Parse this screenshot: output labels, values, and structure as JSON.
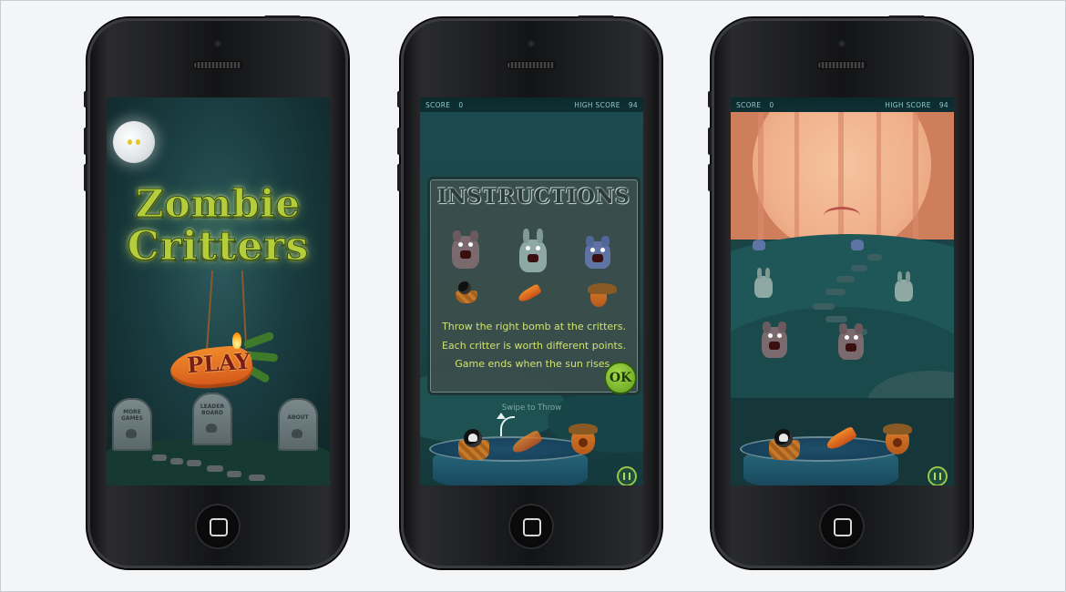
{
  "screen1": {
    "title_line1": "Zombie",
    "title_line2": "Critters",
    "play_label": "PLAY",
    "tombstones": [
      {
        "label": "MORE\nGAMES"
      },
      {
        "label": "LEADER\nBOARD"
      },
      {
        "label": "ABOUT"
      }
    ]
  },
  "screen2": {
    "hud": {
      "score_label": "SCORE",
      "score_value": "0",
      "high_label": "HIGH SCORE",
      "high_value": "94"
    },
    "instructions_title": "INSTRUCTIONS",
    "lines": [
      "Throw the right bomb at the critters.",
      "Each critter is worth different points.",
      "Game ends when the sun rises."
    ],
    "ok_label": "OK",
    "swipe_hint": "Swipe to Throw"
  },
  "screen3": {
    "hud": {
      "score_label": "SCORE",
      "score_value": "0",
      "high_label": "HIGH SCORE",
      "high_value": "94"
    }
  },
  "colors": {
    "title_green": "#b6cd3b",
    "hud_text": "#8fc7c8",
    "instruction_text": "#cfe370",
    "page_bg": "#f2f3f5"
  }
}
